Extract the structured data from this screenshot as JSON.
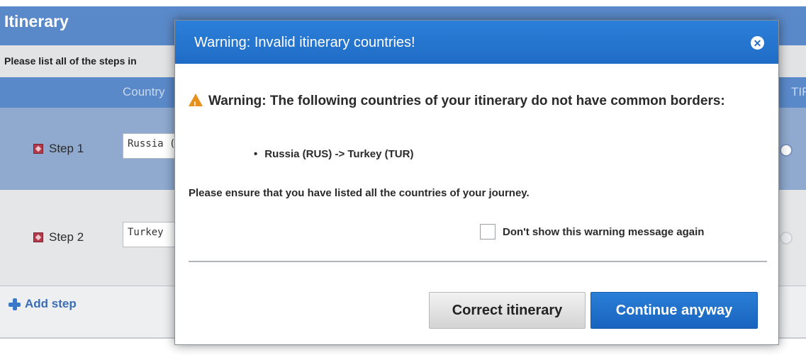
{
  "background": {
    "title": "Itinerary",
    "instruction": "Please list all of the steps in",
    "column_headers": {
      "country": "Country",
      "tir": "TIR"
    },
    "steps": [
      {
        "label": "Step 1",
        "country_value": "Russia ("
      },
      {
        "label": "Step 2",
        "country_value": "Turkey"
      }
    ],
    "add_step_label": "Add step"
  },
  "dialog": {
    "title": "Warning: Invalid itinerary countries!",
    "close_icon": "close-circle-icon",
    "warning_icon": "warning-triangle-icon",
    "warning_text": "Warning: The following countries of your itinerary do not have common borders:",
    "pairs": [
      "Russia (RUS) -> Turkey (TUR)"
    ],
    "ensure_text": "Please ensure that you have listed all the countries of your journey.",
    "dont_show_label": "Don't show this warning message again",
    "dont_show_checked": false,
    "correct_button": "Correct itinerary",
    "continue_button": "Continue anyway"
  },
  "colors": {
    "header_blue": "#5a89c9",
    "dialog_blue": "#1f6cc6",
    "warning_orange": "#e8901c"
  }
}
